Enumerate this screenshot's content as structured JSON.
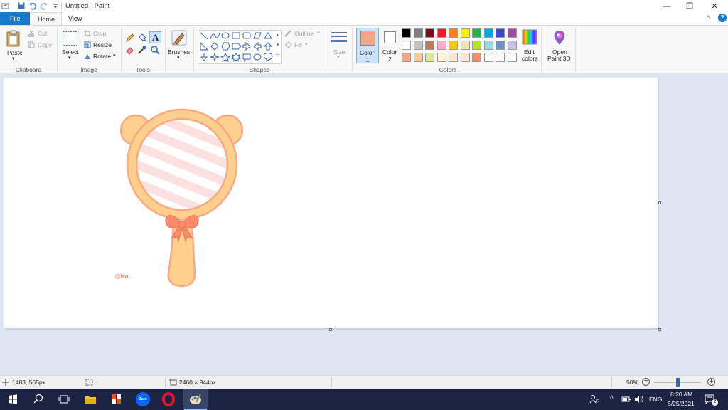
{
  "window": {
    "title": "Untitled - Paint",
    "controls": {
      "minimize": "—",
      "restore": "❐",
      "close": "✕"
    },
    "help_icon": "?",
    "collapse_icon": "^"
  },
  "menu": {
    "tabs": [
      "File",
      "Home",
      "View"
    ],
    "active_tab": "Home"
  },
  "ribbon": {
    "clipboard": {
      "paste": "Paste",
      "cut": "Cut",
      "copy": "Copy",
      "label": "Clipboard"
    },
    "image": {
      "select": "Select",
      "crop": "Crop",
      "resize": "Resize",
      "rotate": "Rotate",
      "label": "Image"
    },
    "tools": {
      "label": "Tools"
    },
    "brushes": {
      "label": "Brushes"
    },
    "shapes": {
      "outline": "Outline",
      "fill": "Fill",
      "label": "Shapes"
    },
    "size": {
      "label": "Size"
    },
    "color1": {
      "line1": "Color",
      "line2": "1",
      "value": "#f4a58a"
    },
    "color2": {
      "line1": "Color",
      "line2": "2",
      "value": "#ffffff"
    },
    "edit_colors": {
      "line1": "Edit",
      "line2": "colors"
    },
    "open_paint3d": {
      "line1": "Open",
      "line2": "Paint 3D"
    },
    "colors_label": "Colors",
    "palette_row1": [
      "#000000",
      "#7f7f7f",
      "#880015",
      "#ed1c24",
      "#ff7f27",
      "#fff200",
      "#22b14c",
      "#00a2e8",
      "#3f48cc",
      "#a349a4"
    ],
    "palette_row2": [
      "#ffffff",
      "#c3c3c3",
      "#b97a57",
      "#ffaec9",
      "#ffc90e",
      "#efe4b0",
      "#b5e61d",
      "#99d9ea",
      "#7092be",
      "#c8bfe7"
    ],
    "palette_row3": [
      "#f4a58a",
      "#fbcb90",
      "#d9ec8f",
      "#fdf1d6",
      "#fce4d3",
      "#fde4d7",
      "#f68b69",
      "#ffffff",
      "#ffffff",
      "#ffffff"
    ]
  },
  "canvas": {
    "watermark": "@Ko",
    "colors": {
      "peach": "#ffcf8e",
      "outline": "#f8a882",
      "stripe": "#fde0e0",
      "bow": "#f98a6c"
    }
  },
  "status": {
    "cursor_pos": "1483, 565px",
    "image_size": "2460 × 944px",
    "zoom": "50%",
    "zoom_slider_fraction": 0.5
  },
  "taskbar": {
    "language": "ENG",
    "time": "8:20 AM",
    "date": "5/25/2021",
    "notification_count": "2",
    "zalo_label": "Zalo"
  }
}
